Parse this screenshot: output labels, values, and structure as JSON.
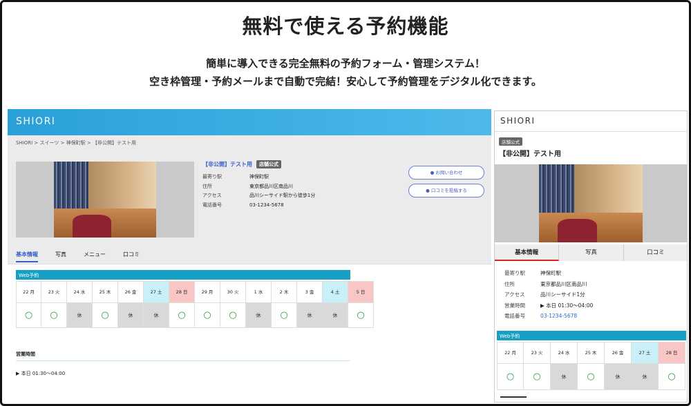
{
  "headline": "無料で使える予約機能",
  "subline1": "簡単に導入できる完全無料の予約フォーム・管理システム！",
  "subline2": "空き枠管理・予約メールまで自動で完結！安心して予約管理をデジタル化できます。",
  "desktop": {
    "brand": "SHIORI",
    "breadcrumb": "SHIORI > スイーツ > 神保町駅 > 【非公開】テスト用",
    "shop_title": "【非公開】テスト用",
    "badge": "店舗公式",
    "info": [
      {
        "key": "最寄り駅",
        "val": "神保町駅"
      },
      {
        "key": "住所",
        "val": "東京都品川区南品川"
      },
      {
        "key": "アクセス",
        "val": "品川シーサイド駅から徒歩1分"
      },
      {
        "key": "電話番号",
        "val": "03-1234-5678"
      }
    ],
    "contact_button": "お問い合わせ",
    "review_button": "口コミを投稿する",
    "tabs": [
      "基本情報",
      "写真",
      "メニュー",
      "口コミ"
    ],
    "reservation_title": "Web予約",
    "days": [
      {
        "date": "22 月",
        "mark": "○",
        "type": "wd"
      },
      {
        "date": "23 火",
        "mark": "○",
        "type": "wd"
      },
      {
        "date": "24 水",
        "mark": "休",
        "type": "wd"
      },
      {
        "date": "25 木",
        "mark": "○",
        "type": "wd"
      },
      {
        "date": "26 金",
        "mark": "休",
        "type": "wd"
      },
      {
        "date": "27 土",
        "mark": "休",
        "type": "sat"
      },
      {
        "date": "28 日",
        "mark": "○",
        "type": "sun"
      },
      {
        "date": "29 月",
        "mark": "○",
        "type": "wd"
      },
      {
        "date": "30 火",
        "mark": "○",
        "type": "wd"
      },
      {
        "date": "1 水",
        "mark": "休",
        "type": "wd"
      },
      {
        "date": "2 木",
        "mark": "○",
        "type": "wd"
      },
      {
        "date": "3 金",
        "mark": "休",
        "type": "wd"
      },
      {
        "date": "4 土",
        "mark": "休",
        "type": "sat"
      },
      {
        "date": "5 日",
        "mark": "○",
        "type": "sun"
      }
    ],
    "hours_title": "営業時間",
    "hours_value": "▶ 本日 01:30〜04:00"
  },
  "mobile": {
    "brand": "SHIORI",
    "badge": "店舗公式",
    "shop_title": "【非公開】テスト用",
    "tabs": [
      "基本情報",
      "写真",
      "口コミ"
    ],
    "info": [
      {
        "key": "最寄り駅",
        "val": "神保町駅"
      },
      {
        "key": "住所",
        "val": "東京都品川区南品川"
      },
      {
        "key": "アクセス",
        "val": "品川シーサイド1分"
      },
      {
        "key": "営業時間",
        "val": "▶ 本日 01:30〜04:00"
      },
      {
        "key": "電話番号",
        "val": "03-1234-5678"
      }
    ],
    "reservation_title": "Web予約",
    "days": [
      {
        "date": "22 月",
        "mark": "○",
        "type": "wd"
      },
      {
        "date": "23 火",
        "mark": "○",
        "type": "wd"
      },
      {
        "date": "24 水",
        "mark": "休",
        "type": "wd"
      },
      {
        "date": "25 木",
        "mark": "○",
        "type": "wd"
      },
      {
        "date": "26 金",
        "mark": "休",
        "type": "wd"
      },
      {
        "date": "27 土",
        "mark": "休",
        "type": "sat"
      },
      {
        "date": "28 日",
        "mark": "○",
        "type": "sun"
      }
    ]
  }
}
